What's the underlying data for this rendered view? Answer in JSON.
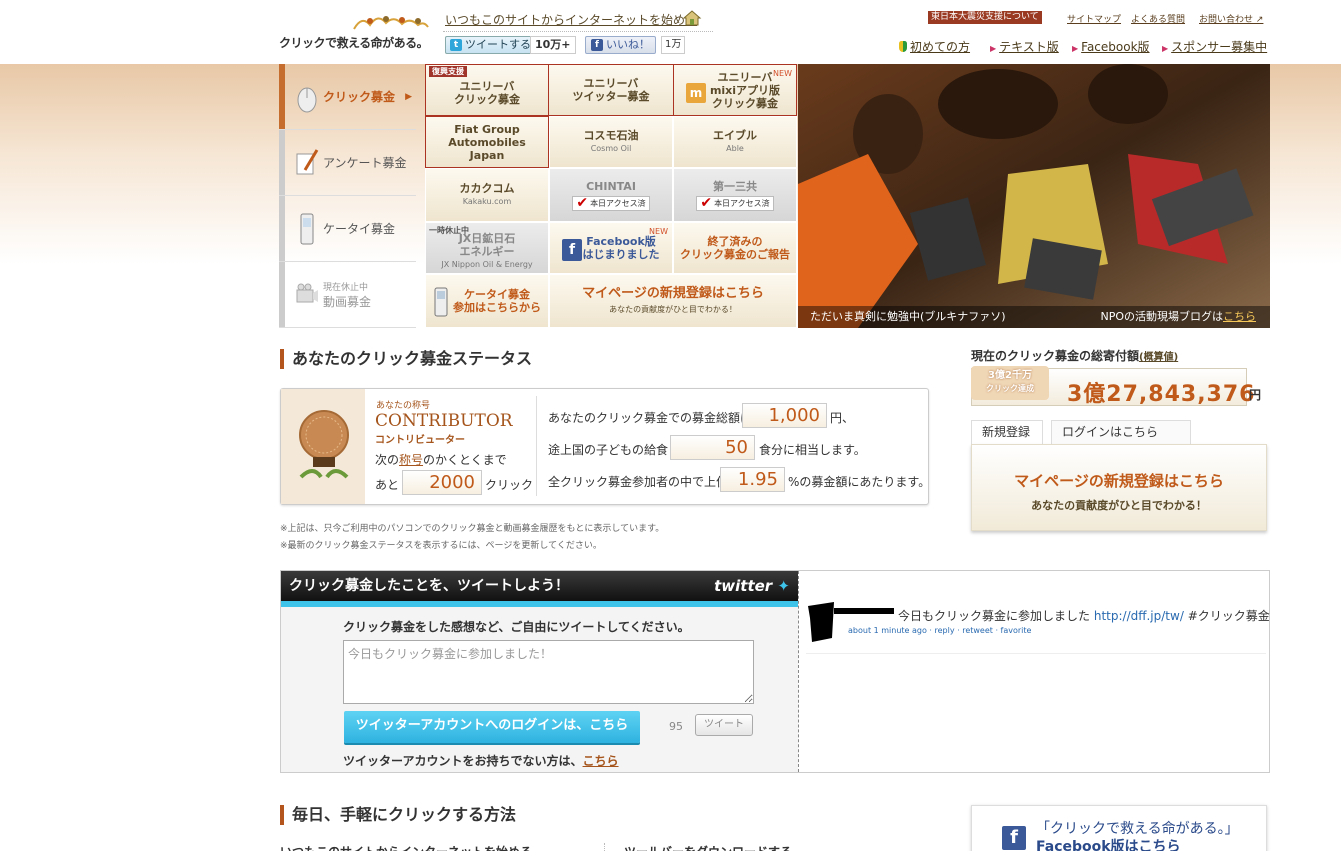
{
  "header": {
    "logo_text": "クリックで救える命がある。",
    "tagline": "いつもこのサイトからインターネットを始める",
    "tweet_label": "ツイートする",
    "tweet_count": "10万+",
    "like_label": "いいね！",
    "like_count": "1万",
    "quake_link": "東日本大震災支援について",
    "sitemap": "サイトマップ",
    "faq": "よくある質問",
    "contact": "お問い合わせ",
    "nav": [
      "初めての方",
      "テキスト版",
      "Facebook版",
      "スポンサー募集中"
    ]
  },
  "sidemenu": {
    "items": [
      {
        "label": "クリック募金"
      },
      {
        "label": "アンケート募金"
      },
      {
        "label": "ケータイ募金"
      },
      {
        "label_small": "現在休止中",
        "label": "動画募金"
      }
    ]
  },
  "grid": {
    "recovery_tag": "復興支援",
    "new_tag": "NEW",
    "unilever_click": [
      "ユニリーバ",
      "クリック募金"
    ],
    "unilever_twitter": [
      "ユニリーバ",
      "ツイッター募金"
    ],
    "unilever_mixi": [
      "ユニリーバ",
      "mixiアプリ版",
      "クリック募金"
    ],
    "fiat": [
      "Fiat Group",
      "Automobiles",
      "Japan"
    ],
    "cosmo": {
      "name": "コスモ石油",
      "sub": "Cosmo Oil"
    },
    "able": {
      "name": "エイブル",
      "sub": "Able"
    },
    "kakaku": {
      "name": "カカクコム",
      "sub": "Kakaku.com"
    },
    "chintai": {
      "name": "CHINTAI",
      "check": "本日アクセス済"
    },
    "daiichi": {
      "name": "第一三共",
      "check": "本日アクセス済"
    },
    "jx": {
      "paused": "一時休止中",
      "name": [
        "JX日鉱日石",
        "エネルギー"
      ],
      "sub": "JX Nippon Oil & Energy"
    },
    "facebook": [
      "Facebook版",
      "はじまりました"
    ],
    "finished": [
      "終了済みの",
      "クリック募金のご報告"
    ],
    "keitai": [
      "ケータイ募金",
      "参加はこちらから"
    ],
    "mypage": {
      "title": "マイページの新規登録はこちら",
      "sub": "あなたの貢献度がひと目でわかる！"
    }
  },
  "photo": {
    "caption": "ただいま真剣に勉強中(ブルキナファソ)",
    "blog_prefix": "NPOの活動現場ブログは",
    "blog_link": "こちら"
  },
  "status": {
    "title": "あなたのクリック募金ステータス",
    "rank_label": "あなたの称号",
    "rank_en": "CONTRIBUTOR",
    "rank_ja": "コントリビューター",
    "next_prefix": "次の",
    "next_link": "称号",
    "next_suffix": "のかくとくまで",
    "remain_prefix": "あと",
    "remain_value": "2000",
    "remain_suffix": "クリック",
    "total_prefix": "あなたのクリック募金での募金総額は",
    "total_value": "1,000",
    "total_suffix": "円、",
    "meal_prefix": "途上国の子どもの給食",
    "meal_value": "50",
    "meal_suffix": "食分に相当します。",
    "rank_prefix": "全クリック募金参加者の中で上位",
    "rank_value": "1.95",
    "rank_suffix": "%の募金額にあたります。",
    "note1": "※上記は、只今ご利用中のパソコンでのクリック募金と動画募金履歴をもとに表示しています。",
    "note2": "※最新のクリック募金ステータスを表示するには、ページを更新してください。"
  },
  "right": {
    "total_label": "現在のクリック募金の総寄付額",
    "total_link": "概算値",
    "badge": [
      "3億2千万",
      "クリック達成"
    ],
    "total_value": "3億27,843,376",
    "total_unit": "円",
    "tab_register": "新規登録",
    "tab_login": "ログインはこちら",
    "register_title": "マイページの新規登録はこちら",
    "register_sub": "あなたの貢献度がひと目でわかる！"
  },
  "twitter": {
    "header": "クリック募金したことを、ツイートしよう！",
    "logo": "twitter",
    "prompt": "クリック募金をした感想など、ご自由にツイートしてください。",
    "textarea": "今日もクリック募金に参加しました！",
    "login_button": "ツイッターアカウントへのログインは、こちら",
    "char_count": "95",
    "tweet_button": "ツイート",
    "no_account_prefix": "ツイッターアカウントをお持ちでない方は、",
    "no_account_link": "こちら",
    "timeline_text": "今日もクリック募金に参加しました",
    "timeline_url": "http://dff.jp/tw/",
    "timeline_hash": "#クリック募金",
    "timeline_meta": "about 1 minute ago · reply · retweet · favorite"
  },
  "howto": {
    "title": "毎日、手軽にクリックする方法",
    "item1": "いつもこのサイトからインターネットを始める",
    "item2": "ツールバーをダウンロードする"
  },
  "fbpromo": {
    "line1": "「クリックで救える命がある。」",
    "line2": "Facebook版はこちら"
  },
  "colors": {
    "accent": "#c05a1a",
    "brand_bar": "#b3551c",
    "twitter_blue": "#3ec3ea",
    "facebook": "#3b5998"
  }
}
